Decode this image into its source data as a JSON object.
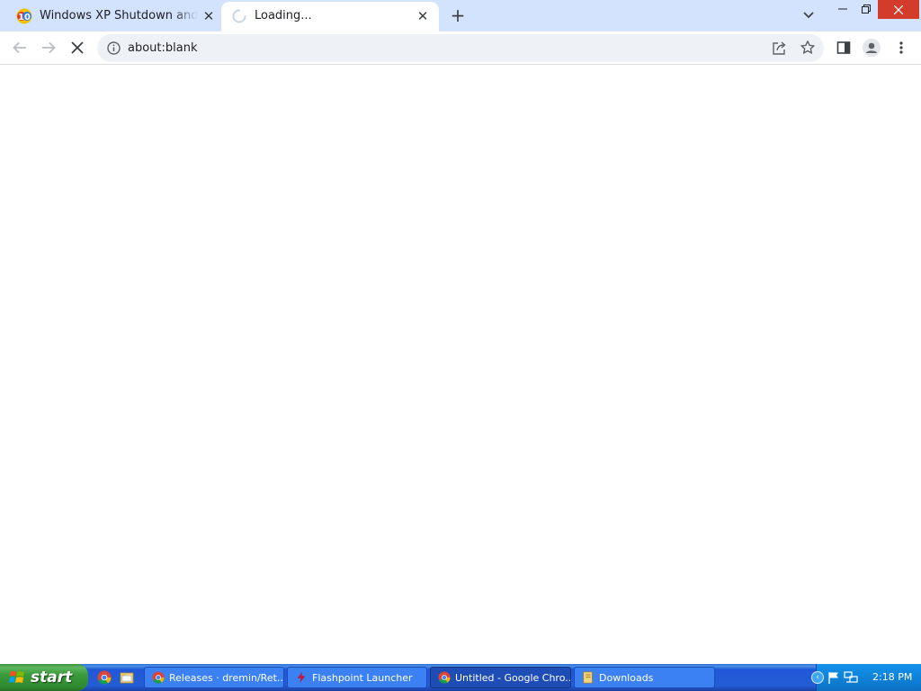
{
  "browser": {
    "tabs": [
      {
        "title": "Windows XP Shutdown and Lo",
        "close": "✕"
      },
      {
        "title": "Loading...",
        "close": "✕"
      }
    ],
    "new_tab": "+",
    "address": "about:blank"
  },
  "window_controls": {
    "minimize": "—",
    "restore": "❐",
    "close": "✕"
  },
  "taskbar": {
    "start_label": "start",
    "tasks": [
      {
        "label": "Releases · dremin/Ret...",
        "icon": "chrome-icon"
      },
      {
        "label": "Flashpoint Launcher",
        "icon": "flashpoint-icon"
      },
      {
        "label": "Untitled - Google Chro...",
        "icon": "chrome-icon"
      },
      {
        "label": "Downloads",
        "icon": "folder-icon"
      }
    ],
    "tray_expand": "‹",
    "clock": "2:18 PM"
  }
}
